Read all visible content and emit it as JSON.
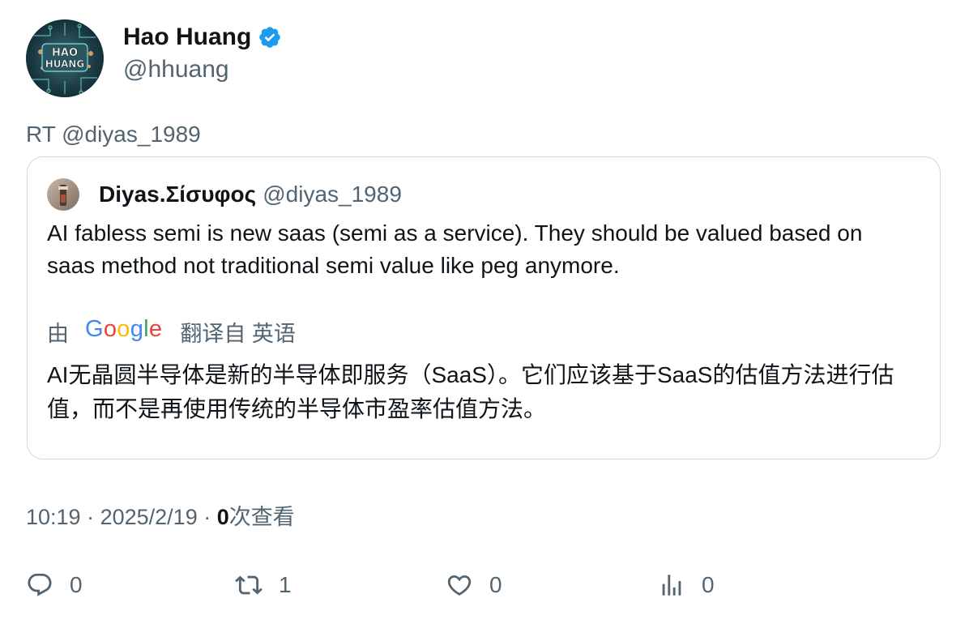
{
  "author": {
    "name": "Hao Huang",
    "handle": "@hhuang",
    "avatar_text": "HAO HUANG",
    "verified_color": "#1d9bf0"
  },
  "retweet_label": "RT @diyas_1989",
  "quote": {
    "name": "Diyas.Σίσυφος",
    "handle": "@diyas_1989",
    "text": "AI fabless semi is new saas (semi as a service). They should be valued based on saas method not traditional semi value like peg anymore.",
    "translation": {
      "prefix": "由",
      "provider": "Google",
      "suffix": "翻译自 英语",
      "text": "AI无晶圆半导体是新的半导体即服务（SaaS）。它们应该基于SaaS的估值方法进行估值，而不是再使用传统的半导体市盈率估值方法。"
    }
  },
  "meta": {
    "time": "10:19",
    "separator": "·",
    "date": "2025/2/19",
    "views_count": "0",
    "views_label": "次查看"
  },
  "actions": {
    "replies": "0",
    "retweets": "1",
    "likes": "0",
    "views": "0"
  },
  "colors": {
    "text_primary": "#0f1419",
    "text_secondary": "#536471",
    "border": "#cfd9de",
    "google_blue": "#4285f4",
    "google_red": "#ea4335",
    "google_yellow": "#fbbc05",
    "google_green": "#34a853"
  }
}
